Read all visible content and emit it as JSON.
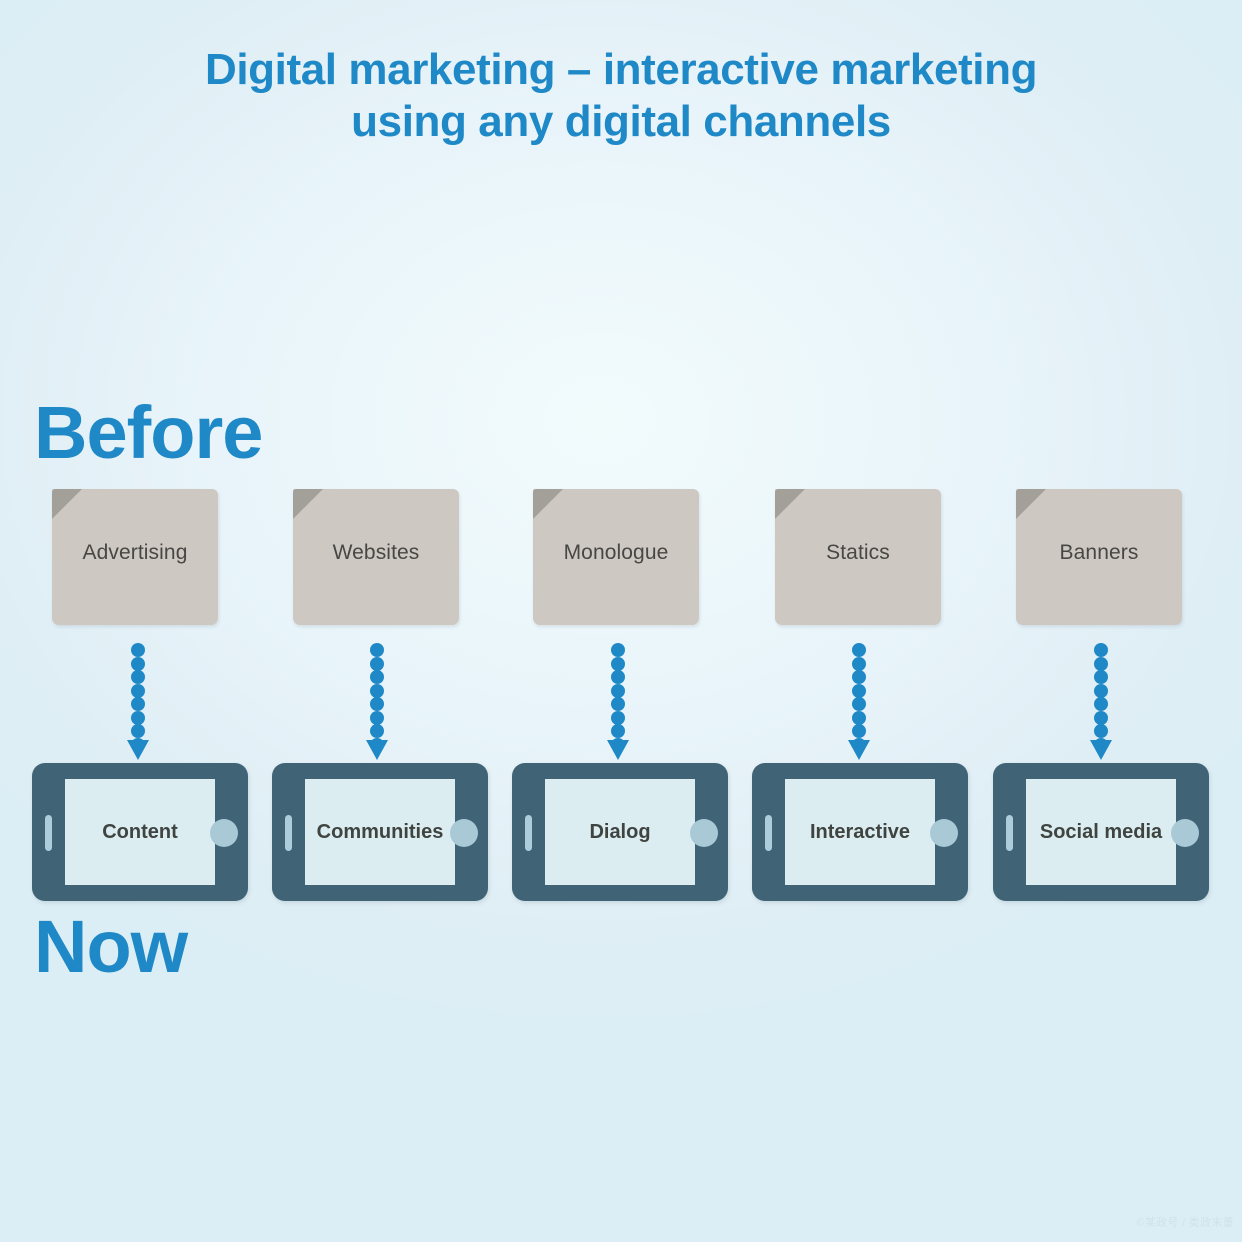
{
  "title": {
    "line1": "Digital marketing – interactive marketing",
    "line2": "using any digital channels"
  },
  "sections": {
    "before_label": "Before",
    "now_label": "Now"
  },
  "before_items": [
    {
      "label": "Advertising"
    },
    {
      "label": "Websites"
    },
    {
      "label": "Monologue"
    },
    {
      "label": "Statics"
    },
    {
      "label": "Banners"
    }
  ],
  "now_items": [
    {
      "label": "Content",
      "two_line": false
    },
    {
      "label": "Communities",
      "two_line": false
    },
    {
      "label": "Dialog",
      "two_line": false
    },
    {
      "label": "Interactive",
      "two_line": false
    },
    {
      "label": "Social media",
      "two_line": true
    }
  ],
  "arrows": {
    "count": 5,
    "dots_per_arrow": 8,
    "direction": "down",
    "icon": "dotted-down-arrow-icon"
  },
  "watermark": "©某政号 / 类政末董",
  "colors": {
    "accent_blue": "#1f89c7",
    "paper_fill": "#cdc8c1",
    "paper_fold": "#a3a099",
    "paper_text": "#474745",
    "tablet_body": "#406476",
    "tablet_screen": "#dcedf1",
    "tablet_text": "#3f4441",
    "background_light": "#f2fbfc",
    "background_edge": "#dceef5"
  }
}
